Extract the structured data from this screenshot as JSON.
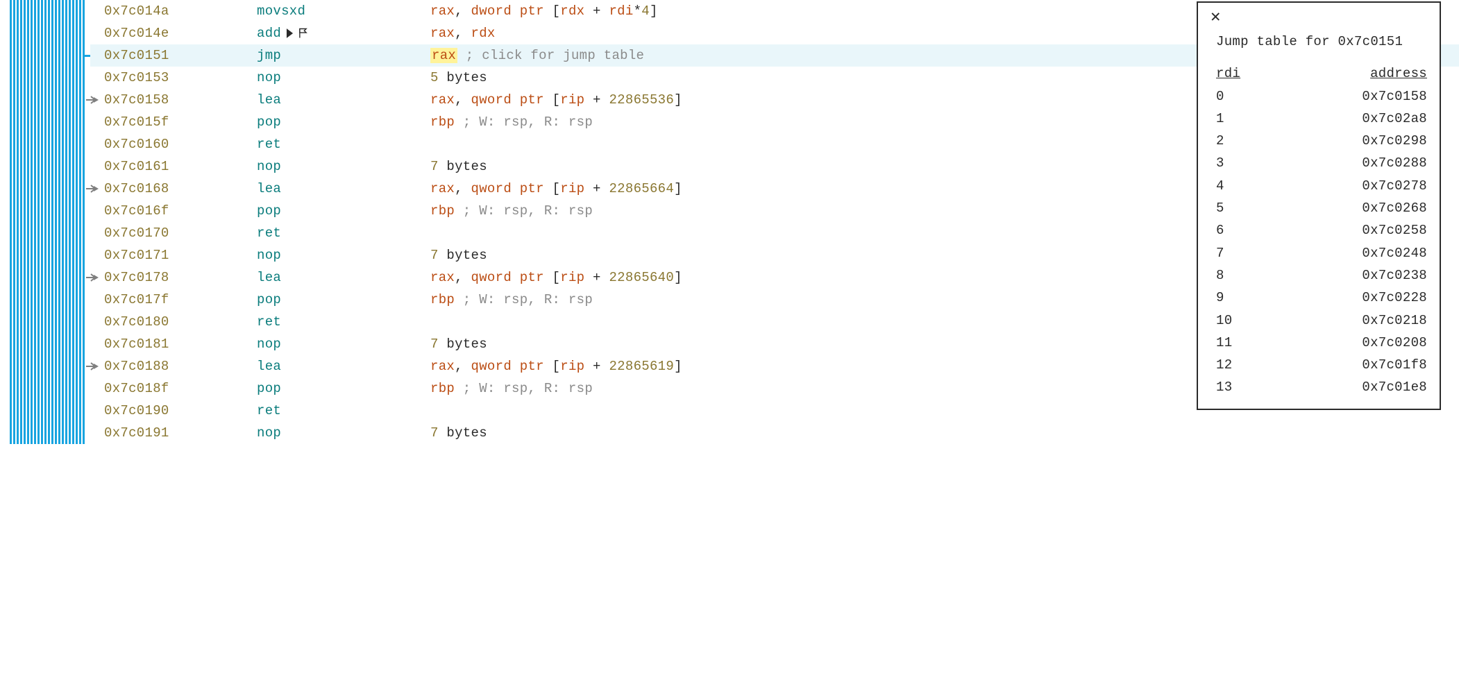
{
  "rows": [
    {
      "addr": "0x7c014a",
      "mnemonic": "movsxd",
      "operands": [
        {
          "t": "reg",
          "v": "rax"
        },
        {
          "t": "punc",
          "v": ", "
        },
        {
          "t": "kw",
          "v": "dword ptr"
        },
        {
          "t": "punc",
          "v": " ["
        },
        {
          "t": "reg",
          "v": "rdx"
        },
        {
          "t": "punc",
          "v": " + "
        },
        {
          "t": "reg",
          "v": "rdi"
        },
        {
          "t": "punc",
          "v": "*"
        },
        {
          "t": "num",
          "v": "4"
        },
        {
          "t": "punc",
          "v": "]"
        }
      ]
    },
    {
      "addr": "0x7c014e",
      "mnemonic": "add",
      "annot": true,
      "operands": [
        {
          "t": "reg",
          "v": "rax"
        },
        {
          "t": "punc",
          "v": ", "
        },
        {
          "t": "reg",
          "v": "rdx"
        }
      ]
    },
    {
      "addr": "0x7c0151",
      "mnemonic": "jmp",
      "highlighted": true,
      "connect": true,
      "operands": [
        {
          "t": "hlreg",
          "v": "rax"
        },
        {
          "t": "comment",
          "v": " ; click for jump table"
        }
      ]
    },
    {
      "addr": "0x7c0153",
      "mnemonic": "nop",
      "operands": [
        {
          "t": "num",
          "v": "5"
        },
        {
          "t": "bytes",
          "v": " bytes"
        }
      ]
    },
    {
      "addr": "0x7c0158",
      "mnemonic": "lea",
      "arrow": true,
      "operands": [
        {
          "t": "reg",
          "v": "rax"
        },
        {
          "t": "punc",
          "v": ", "
        },
        {
          "t": "kw",
          "v": "qword ptr"
        },
        {
          "t": "punc",
          "v": " ["
        },
        {
          "t": "reg",
          "v": "rip"
        },
        {
          "t": "punc",
          "v": " + "
        },
        {
          "t": "num",
          "v": "22865536"
        },
        {
          "t": "punc",
          "v": "]"
        }
      ]
    },
    {
      "addr": "0x7c015f",
      "mnemonic": "pop",
      "operands": [
        {
          "t": "reg",
          "v": "rbp"
        },
        {
          "t": "comment",
          "v": " ; W: rsp, R: rsp"
        }
      ]
    },
    {
      "addr": "0x7c0160",
      "mnemonic": "ret",
      "operands": []
    },
    {
      "addr": "0x7c0161",
      "mnemonic": "nop",
      "operands": [
        {
          "t": "num",
          "v": "7"
        },
        {
          "t": "bytes",
          "v": " bytes"
        }
      ]
    },
    {
      "addr": "0x7c0168",
      "mnemonic": "lea",
      "arrow": true,
      "operands": [
        {
          "t": "reg",
          "v": "rax"
        },
        {
          "t": "punc",
          "v": ", "
        },
        {
          "t": "kw",
          "v": "qword ptr"
        },
        {
          "t": "punc",
          "v": " ["
        },
        {
          "t": "reg",
          "v": "rip"
        },
        {
          "t": "punc",
          "v": " + "
        },
        {
          "t": "num",
          "v": "22865664"
        },
        {
          "t": "punc",
          "v": "]"
        }
      ]
    },
    {
      "addr": "0x7c016f",
      "mnemonic": "pop",
      "operands": [
        {
          "t": "reg",
          "v": "rbp"
        },
        {
          "t": "comment",
          "v": " ; W: rsp, R: rsp"
        }
      ]
    },
    {
      "addr": "0x7c0170",
      "mnemonic": "ret",
      "operands": []
    },
    {
      "addr": "0x7c0171",
      "mnemonic": "nop",
      "operands": [
        {
          "t": "num",
          "v": "7"
        },
        {
          "t": "bytes",
          "v": " bytes"
        }
      ]
    },
    {
      "addr": "0x7c0178",
      "mnemonic": "lea",
      "arrow": true,
      "operands": [
        {
          "t": "reg",
          "v": "rax"
        },
        {
          "t": "punc",
          "v": ", "
        },
        {
          "t": "kw",
          "v": "qword ptr"
        },
        {
          "t": "punc",
          "v": " ["
        },
        {
          "t": "reg",
          "v": "rip"
        },
        {
          "t": "punc",
          "v": " + "
        },
        {
          "t": "num",
          "v": "22865640"
        },
        {
          "t": "punc",
          "v": "]"
        }
      ]
    },
    {
      "addr": "0x7c017f",
      "mnemonic": "pop",
      "operands": [
        {
          "t": "reg",
          "v": "rbp"
        },
        {
          "t": "comment",
          "v": " ; W: rsp, R: rsp"
        }
      ]
    },
    {
      "addr": "0x7c0180",
      "mnemonic": "ret",
      "operands": []
    },
    {
      "addr": "0x7c0181",
      "mnemonic": "nop",
      "operands": [
        {
          "t": "num",
          "v": "7"
        },
        {
          "t": "bytes",
          "v": " bytes"
        }
      ]
    },
    {
      "addr": "0x7c0188",
      "mnemonic": "lea",
      "arrow": true,
      "operands": [
        {
          "t": "reg",
          "v": "rax"
        },
        {
          "t": "punc",
          "v": ", "
        },
        {
          "t": "kw",
          "v": "qword ptr"
        },
        {
          "t": "punc",
          "v": " ["
        },
        {
          "t": "reg",
          "v": "rip"
        },
        {
          "t": "punc",
          "v": " + "
        },
        {
          "t": "num",
          "v": "22865619"
        },
        {
          "t": "punc",
          "v": "]"
        }
      ]
    },
    {
      "addr": "0x7c018f",
      "mnemonic": "pop",
      "operands": [
        {
          "t": "reg",
          "v": "rbp"
        },
        {
          "t": "comment",
          "v": " ; W: rsp, R: rsp"
        }
      ]
    },
    {
      "addr": "0x7c0190",
      "mnemonic": "ret",
      "operands": []
    },
    {
      "addr": "0x7c0191",
      "mnemonic": "nop",
      "operands": [
        {
          "t": "num",
          "v": "7"
        },
        {
          "t": "bytes",
          "v": " bytes"
        }
      ]
    }
  ],
  "jump_panel": {
    "title": "Jump table for 0x7c0151",
    "head_index": "rdi",
    "head_address": "address",
    "entries": [
      {
        "i": "0",
        "a": "0x7c0158"
      },
      {
        "i": "1",
        "a": "0x7c02a8"
      },
      {
        "i": "2",
        "a": "0x7c0298"
      },
      {
        "i": "3",
        "a": "0x7c0288"
      },
      {
        "i": "4",
        "a": "0x7c0278"
      },
      {
        "i": "5",
        "a": "0x7c0268"
      },
      {
        "i": "6",
        "a": "0x7c0258"
      },
      {
        "i": "7",
        "a": "0x7c0248"
      },
      {
        "i": "8",
        "a": "0x7c0238"
      },
      {
        "i": "9",
        "a": "0x7c0228"
      },
      {
        "i": "10",
        "a": "0x7c0218"
      },
      {
        "i": "11",
        "a": "0x7c0208"
      },
      {
        "i": "12",
        "a": "0x7c01f8"
      },
      {
        "i": "13",
        "a": "0x7c01e8"
      }
    ]
  },
  "flow_line_count": 22
}
